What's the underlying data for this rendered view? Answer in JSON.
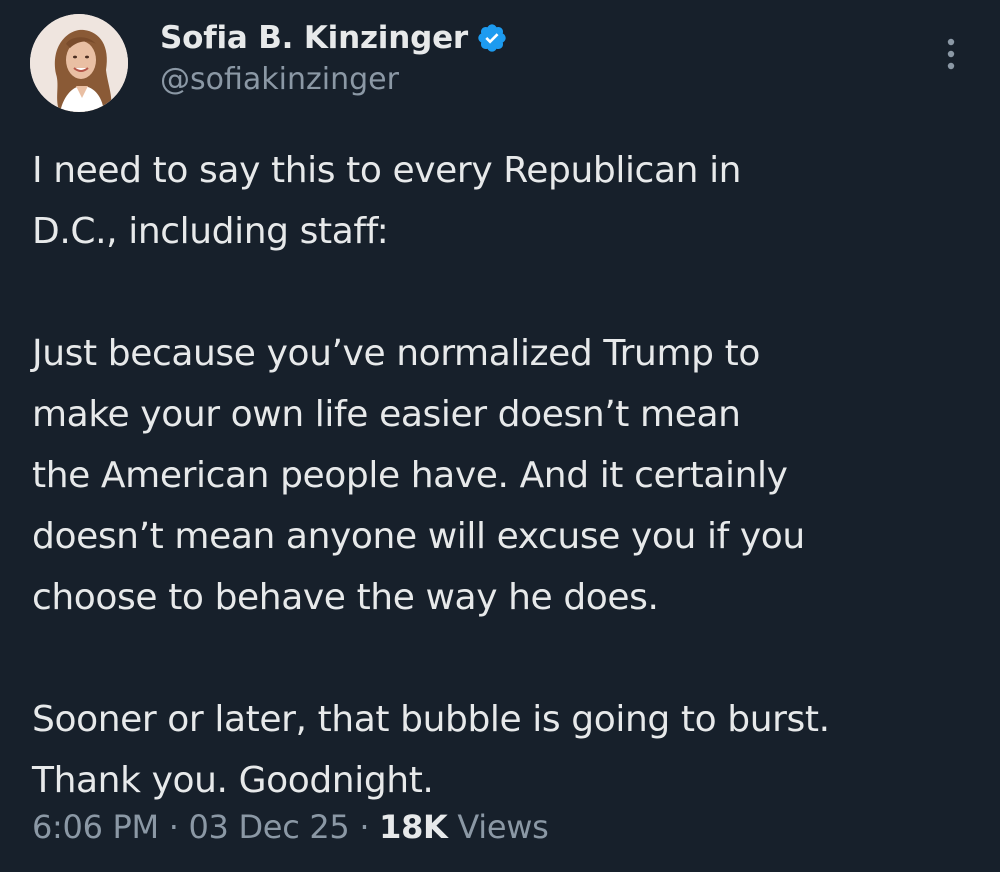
{
  "author": {
    "display_name": "Sofia B. Kinzinger",
    "handle": "@sofiakinzinger",
    "verified_icon": "verified-badge-icon",
    "avatar_icon": "profile-photo"
  },
  "menu": {
    "icon": "more-options-icon"
  },
  "tweet": {
    "paragraphs": [
      {
        "lines": [
          "I need to say this to every Republican in",
          "D.C., including staff:"
        ]
      },
      {
        "lines": [
          "Just because you’ve normalized Trump to",
          "make your own life easier doesn’t mean",
          "the American people have. And it certainly",
          "doesn’t mean anyone will excuse you if you",
          "choose to behave the way he does."
        ]
      },
      {
        "lines": [
          "Sooner or later, that bubble is going to burst.",
          "Thank you. Goodnight."
        ]
      }
    ]
  },
  "meta": {
    "time": "6:06 PM",
    "separator": " · ",
    "date": "03 Dec 25",
    "views_count": "18K",
    "views_label": " Views"
  },
  "colors": {
    "background": "#17202b",
    "text_primary": "#e7e9ea",
    "text_secondary": "#8b98a5",
    "verified_blue": "#1d9bf0"
  }
}
